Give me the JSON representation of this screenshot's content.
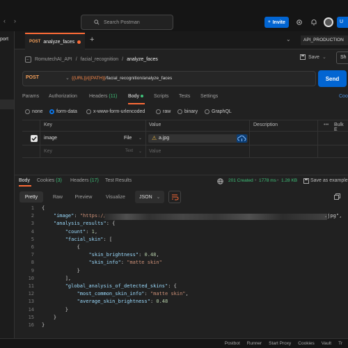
{
  "topbar": {
    "search_placeholder": "Search Postman",
    "invite_label": "Invite",
    "profile_label": "U"
  },
  "sidebar": {
    "import_label": "port"
  },
  "tabs": {
    "active_method": "POST",
    "active_label": "analyze_faces",
    "environment": "API_PRODUCTION"
  },
  "breadcrumb": {
    "items": [
      "RomutechAI_API",
      "facial_recognition",
      "analyze_faces"
    ],
    "save_label": "Save",
    "share_label": "Sh"
  },
  "request": {
    "method": "POST",
    "url_vars": "{{URL}}/{{PATH}}",
    "url_path": "/facial_recognition/analyze_faces",
    "send_label": "Send",
    "cookies_link": "Coo"
  },
  "request_tabs": {
    "params": "Params",
    "authorization": "Authorization",
    "headers": "Headers",
    "headers_count": "(11)",
    "body": "Body",
    "scripts": "Scripts",
    "tests": "Tests",
    "settings": "Settings"
  },
  "body_types": [
    "none",
    "form-data",
    "x-www-form-urlencoded",
    "raw",
    "binary",
    "GraphQL"
  ],
  "form_table": {
    "headers": [
      "Key",
      "Value",
      "Description",
      "Bulk E"
    ],
    "rows": [
      {
        "key": "image",
        "type": "File",
        "value": "a.jpg"
      }
    ],
    "placeholder": {
      "key": "Key",
      "type": "Text",
      "value": "Value"
    }
  },
  "response_tabs": {
    "body": "Body",
    "cookies": "Cookies",
    "cookies_count": "(3)",
    "headers": "Headers",
    "headers_count": "(17)",
    "test_results": "Test Results"
  },
  "response_meta": {
    "status": "201 Created",
    "time": "1778 ms",
    "size": "1.28 KB",
    "save_example": "Save as example"
  },
  "format": {
    "modes": [
      "Pretty",
      "Raw",
      "Preview",
      "Visualize"
    ],
    "selected_type": "JSON"
  },
  "code_lines": [
    "{",
    "    \"image\": \"https://",
    "    \"analysis_results\": {",
    "        \"count\": 1,",
    "        \"facial_skin\": [",
    "            {",
    "                \"skin_brightness\": 0.48,",
    "                \"skin_info\": \"matte skin\"",
    "            }",
    "        ],",
    "        \"global_analysis_of_detected_skins\": {",
    "            \"most_common_skin_info\": \"matte skin\",",
    "            \"average_skin_brightness\": 0.48",
    "        }",
    "    }",
    "}"
  ],
  "code_line2_tail": ".jpg\",",
  "statusbar": [
    "Postbot",
    "Runner",
    "Start Proxy",
    "Cookies",
    "Vault",
    "Tr"
  ],
  "colors": {
    "accent_orange": "#ff6c37",
    "primary_blue": "#0265d2",
    "status_green": "#3fc27a"
  }
}
